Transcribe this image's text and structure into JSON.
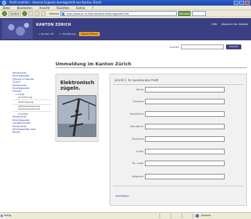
{
  "window": {
    "title": "Profil erstellen - Internet Explorer bereitgestellt von Kanton Zürich"
  },
  "menu": [
    "Datei",
    "Bearbeiten",
    "Ansicht",
    "Favoriten",
    "Extras",
    "?"
  ],
  "toolbar": {
    "back_label": "Zurück",
    "address_label": "Adresse",
    "address_value": "http://www.zh.ch/internet/de/anmeldung/profil.html",
    "go_label": "Wechseln zu"
  },
  "site": {
    "title": "KANTON ZÜRICH",
    "header_links": [
      "Hilfe",
      "Übersicht Ind. Kontakt"
    ],
    "tabs": [
      {
        "label": "> Kanton ZH",
        "active": false
      },
      {
        "label": "> Verwaltung",
        "active": false
      },
      {
        "label": "Bauen/Planen",
        "active": true
      }
    ]
  },
  "search": {
    "label": "Suchen",
    "button_label": "Suchen"
  },
  "page": {
    "title": "Ummeldung im Kanton Zürich"
  },
  "leftnav": [
    {
      "label": "Persönliche",
      "style": "sub"
    },
    {
      "label": "Einstiegsseite",
      "style": "sub"
    },
    {
      "label": "Umzug im Kanton",
      "style": "sub"
    },
    {
      "label": "Zürich",
      "style": "sub"
    },
    {
      "label": "Persönliche",
      "style": "sub"
    },
    {
      "label": "Einstiegsseite",
      "style": "sub"
    },
    {
      "label": "Umzug",
      "style": "sub"
    },
    {
      "label": "> Profil",
      "style": "indent"
    },
    {
      "label": "Anmeldung",
      "style": "sub2"
    },
    {
      "label": "Übertragung",
      "style": "sub2"
    },
    {
      "label": "Adressverwaltung",
      "style": "sub2"
    },
    {
      "label": "Adressverzeichnis",
      "style": "sub2"
    },
    {
      "label": "Umzüge",
      "style": "sub2"
    },
    {
      "label": "Persönliche",
      "style": "sub"
    },
    {
      "label": "Einstiegsseite",
      "style": "sub"
    },
    {
      "label": "Landwirtschaft",
      "style": "sub"
    },
    {
      "label": "Persönliche",
      "style": "sub"
    },
    {
      "label": "Einstiegsseite Auto",
      "style": "sub"
    },
    {
      "label": "fahren",
      "style": "sub"
    }
  ],
  "promo": {
    "text": "Elektronisch zügeln."
  },
  "form": {
    "step_title": "Schritt 1: Ihr bestehendes Profil",
    "fields": [
      {
        "label": "Name"
      },
      {
        "label": "Vorname"
      },
      {
        "label": "Geschlecht"
      },
      {
        "label": "Geb.datum"
      },
      {
        "label": "Zivilstand"
      },
      {
        "label": "e-Mail"
      },
      {
        "label": "Tel. mobil"
      },
      {
        "label": "Bürgerort"
      }
    ],
    "confirm_label": "Bestätigen"
  },
  "status": {
    "left": "Fertig",
    "zone": "Internet"
  }
}
